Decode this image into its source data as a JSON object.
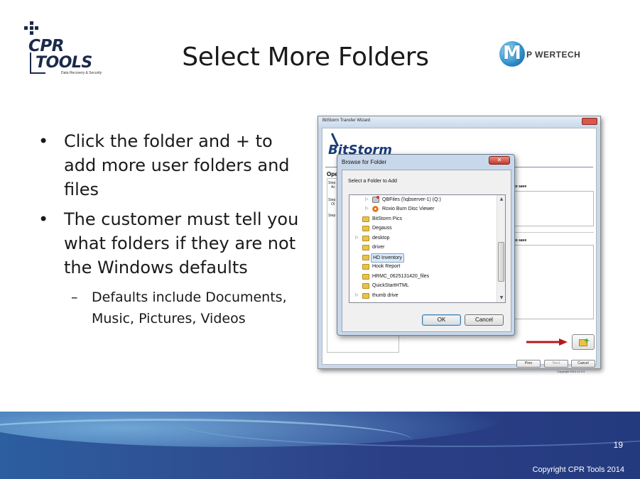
{
  "slide": {
    "title": "Select More Folders",
    "page_number": "19",
    "copyright": "Copyright CPR Tools 2014"
  },
  "logos": {
    "left": {
      "line1": "CPR",
      "line2": "TOOLS",
      "tagline": "Data Recovery & Security"
    },
    "right": {
      "mark": "M",
      "brand": "P WERTECH"
    }
  },
  "bullets": [
    {
      "text": "Click the folder and + to add more user folders and files"
    },
    {
      "text": "The customer must tell you what folders if they are not the Windows defaults"
    }
  ],
  "sub_bullets": [
    {
      "text": "Defaults include Documents, Music, Pictures, Videos"
    }
  ],
  "bullet_symbol": "•",
  "dash_symbol": "–",
  "wizard": {
    "title": "BitStorm Transfer Wizard",
    "logo_text": "BitStorm",
    "section_heading": "Ope",
    "steps": [
      {
        "line1": "Step",
        "line2": "Ac"
      },
      {
        "line1": "Step",
        "line2": "Ol"
      },
      {
        "line1": "Step",
        "line2": ""
      }
    ],
    "save_label_1": "to save",
    "save_label_2": "to save",
    "buttons": {
      "prev": "Prev",
      "next": "Next",
      "cancel": "Cancel"
    },
    "version_text": "Copyright 2014 v1.0.3"
  },
  "dialog": {
    "title": "Browse for Folder",
    "close_glyph": "✕",
    "prompt": "Select a Folder to Add",
    "tree": [
      {
        "label": "QBFiles (\\\\qbserver-1) (Q:)",
        "icon": "network-drive",
        "expander": "▷",
        "indent": 1,
        "selected": false
      },
      {
        "label": "Roxio Burn Disc Viewer",
        "icon": "roxio-disc",
        "expander": "▷",
        "indent": 1,
        "selected": false
      },
      {
        "label": "BitStorm Pics",
        "icon": "folder",
        "expander": "",
        "indent": 0,
        "selected": false
      },
      {
        "label": "Degauss",
        "icon": "folder",
        "expander": "",
        "indent": 0,
        "selected": false
      },
      {
        "label": "desktop",
        "icon": "folder",
        "expander": "▷",
        "indent": 0,
        "selected": false
      },
      {
        "label": "driver",
        "icon": "folder",
        "expander": "",
        "indent": 0,
        "selected": false
      },
      {
        "label": "HD Inventory",
        "icon": "folder",
        "expander": "",
        "indent": 0,
        "selected": true
      },
      {
        "label": "Hook Report",
        "icon": "folder",
        "expander": "",
        "indent": 0,
        "selected": false
      },
      {
        "label": "HRMC_0625131420_files",
        "icon": "folder",
        "expander": "",
        "indent": 0,
        "selected": false
      },
      {
        "label": "QuickStartHTML",
        "icon": "folder",
        "expander": "",
        "indent": 0,
        "selected": false
      },
      {
        "label": "thumb drive",
        "icon": "folder",
        "expander": "▷",
        "indent": 0,
        "selected": false
      }
    ],
    "ok_label": "OK",
    "cancel_label": "Cancel"
  },
  "colors": {
    "footer_blue": "#2b3f86",
    "arrow_red": "#b01c1c",
    "folder_yellow": "#e8c24a"
  }
}
